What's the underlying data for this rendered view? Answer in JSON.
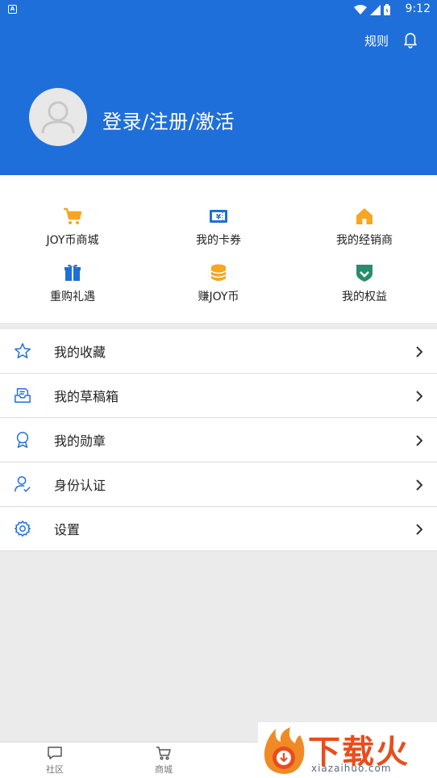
{
  "status_bar": {
    "time": "9:12"
  },
  "header": {
    "rules_label": "规则",
    "login_text": "登录/注册/激活",
    "color": "#1e6fd9"
  },
  "quick_actions": [
    {
      "label": "JOY币商城",
      "icon": "cart-icon"
    },
    {
      "label": "我的卡券",
      "icon": "coupon-icon"
    },
    {
      "label": "我的经销商",
      "icon": "house-icon"
    },
    {
      "label": "重购礼遇",
      "icon": "gift-icon"
    },
    {
      "label": "赚JOY币",
      "icon": "coin-stack-icon"
    },
    {
      "label": "我的权益",
      "icon": "shield-check-icon"
    }
  ],
  "menu": [
    {
      "label": "我的收藏",
      "icon": "star-icon"
    },
    {
      "label": "我的草稿箱",
      "icon": "drafts-icon"
    },
    {
      "label": "我的勋章",
      "icon": "medal-icon"
    },
    {
      "label": "身份认证",
      "icon": "user-verified-icon"
    },
    {
      "label": "设置",
      "icon": "gear-icon"
    }
  ],
  "bottom_nav": [
    {
      "label": "社区",
      "icon": "chat-icon"
    },
    {
      "label": "商城",
      "icon": "cart-icon"
    }
  ],
  "watermark": {
    "text": "下载火",
    "url": "xiazaihuo.com"
  }
}
